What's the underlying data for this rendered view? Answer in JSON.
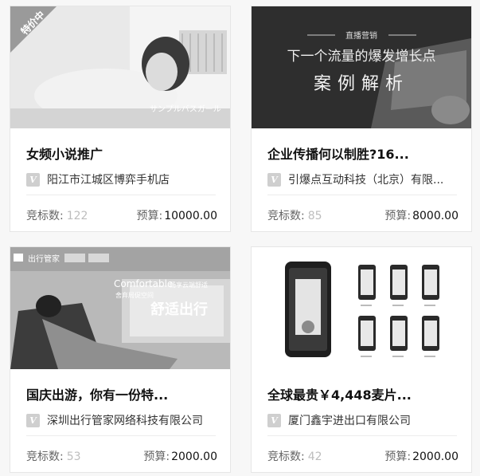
{
  "cards": [
    {
      "tag": "特价中",
      "image_caption": "サンプルバスガール",
      "title": "女频小说推广",
      "company": "阳江市江城区博弈手机店",
      "bids_label": "竞标数:",
      "bids_value": "122",
      "budget_label": "预算:",
      "budget_value": "10000.00"
    },
    {
      "image_kicker": "直播营销",
      "image_line1": "下一个流量的爆发增长点",
      "image_line2": "案例解析",
      "title": "企业传播何以制胜?16...",
      "company": "引爆点互动科技（北京）有限...",
      "bids_label": "竞标数:",
      "bids_value": "85",
      "budget_label": "预算:",
      "budget_value": "8000.00"
    },
    {
      "image_brand": "出行管家",
      "image_en": "Comfortable",
      "image_sub1": "畅享云端舒适",
      "image_sub2": "舍弃局促空间",
      "image_big": "舒适出行",
      "title": "国庆出游，你有一份特...",
      "company": "深圳出行管家网络科技有限公司",
      "bids_label": "竞标数:",
      "bids_value": "53",
      "budget_label": "预算:",
      "budget_value": "2000.00"
    },
    {
      "title": "全球最贵￥4,448麦片...",
      "company": "厦门鑫宇进出口有限公司",
      "bids_label": "竞标数:",
      "bids_value": "42",
      "budget_label": "预算:",
      "budget_value": "2000.00"
    }
  ],
  "badge_letter": "V",
  "colors": {
    "bids_number": "#bdbdbd",
    "badge_bg": "#cfcfcf",
    "text": "#111111"
  }
}
